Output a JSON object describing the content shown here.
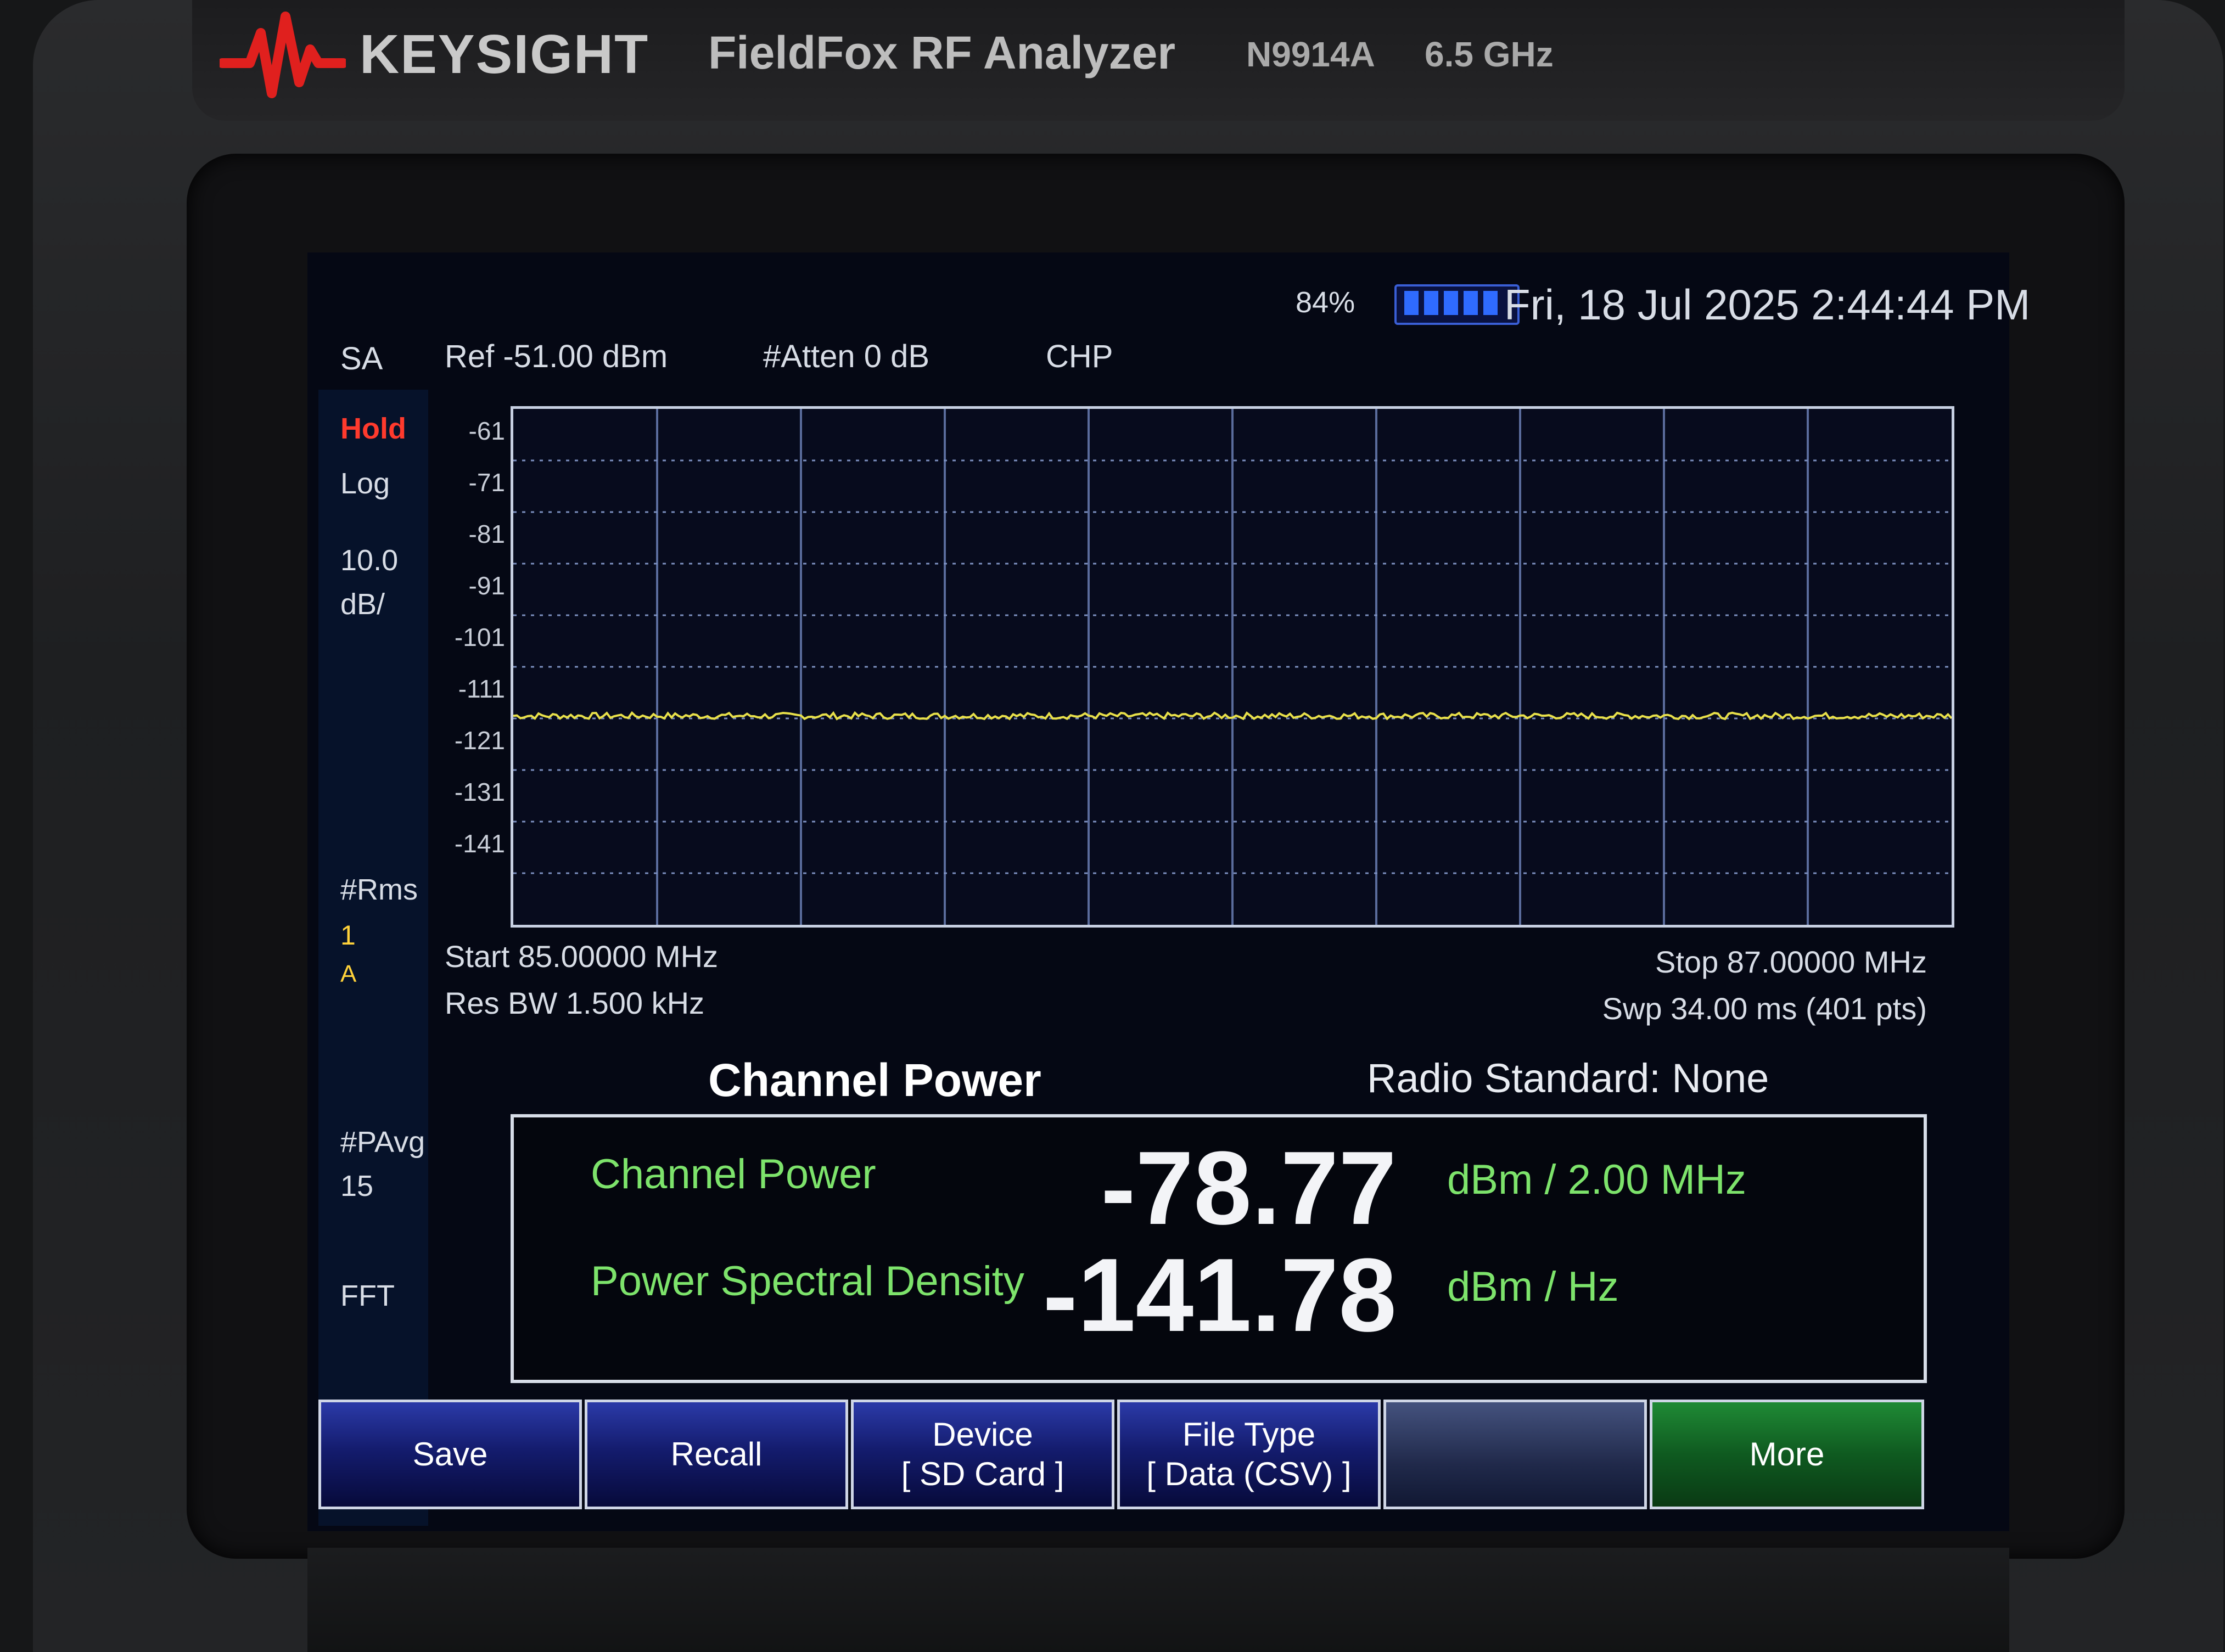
{
  "device": {
    "brand": "KEYSIGHT",
    "product": "FieldFox RF Analyzer",
    "model_number": "N9914A",
    "max_frequency": "6.5 GHz"
  },
  "status": {
    "battery_percent": "84%",
    "datetime": "Fri, 18 Jul 2025 2:44:44 PM"
  },
  "header": {
    "mode": "SA",
    "ref_level": "Ref -51.00 dBm",
    "attenuation": "#Atten 0 dB",
    "measurement": "CHP"
  },
  "left_panel": {
    "hold": "Hold",
    "scale_type": "Log",
    "scale_div_value": "10.0",
    "scale_div_unit": "dB/",
    "detector": "#Rms",
    "trace_number": "1",
    "trace_mode": "A",
    "power_avg_label": "#PAvg",
    "power_avg_count": "15",
    "sweep_type": "FFT"
  },
  "chart_data": {
    "type": "line",
    "y_tick_labels": [
      "-61",
      "-71",
      "-81",
      "-91",
      "-101",
      "-111",
      "-121",
      "-131",
      "-141"
    ],
    "ylim": [
      -151,
      -51
    ],
    "x_range_mhz": [
      85.0,
      87.0
    ],
    "grid": true,
    "series": [
      {
        "color": "#e8e04a",
        "approx_level_dbm": -110.5
      }
    ]
  },
  "sweep": {
    "start": "Start 85.00000 MHz",
    "stop": "Stop 87.00000 MHz",
    "res_bw": "Res BW 1.500 kHz",
    "sweep_time": "Swp 34.00 ms (401 pts)"
  },
  "results": {
    "title": "Channel Power",
    "radio_standard": "Radio Standard: None",
    "channel_power_label": "Channel Power",
    "channel_power_value": "-78.77",
    "channel_power_unit": "dBm / 2.00 MHz",
    "psd_label": "Power Spectral Density",
    "psd_value": "-141.78",
    "psd_unit": "dBm / Hz"
  },
  "softkeys": {
    "save": "Save",
    "recall": "Recall",
    "device_line1": "Device",
    "device_line2": "[ SD Card ]",
    "filetype_line1": "File Type",
    "filetype_line2": "[ Data (CSV) ]",
    "blank": "",
    "more": "More"
  },
  "colors": {
    "trace": "#e8e04a",
    "result_label": "#7de36b",
    "hold": "#ff3a2d",
    "softkey_blue": "#141c6e",
    "softkey_green": "#0f5a20"
  }
}
